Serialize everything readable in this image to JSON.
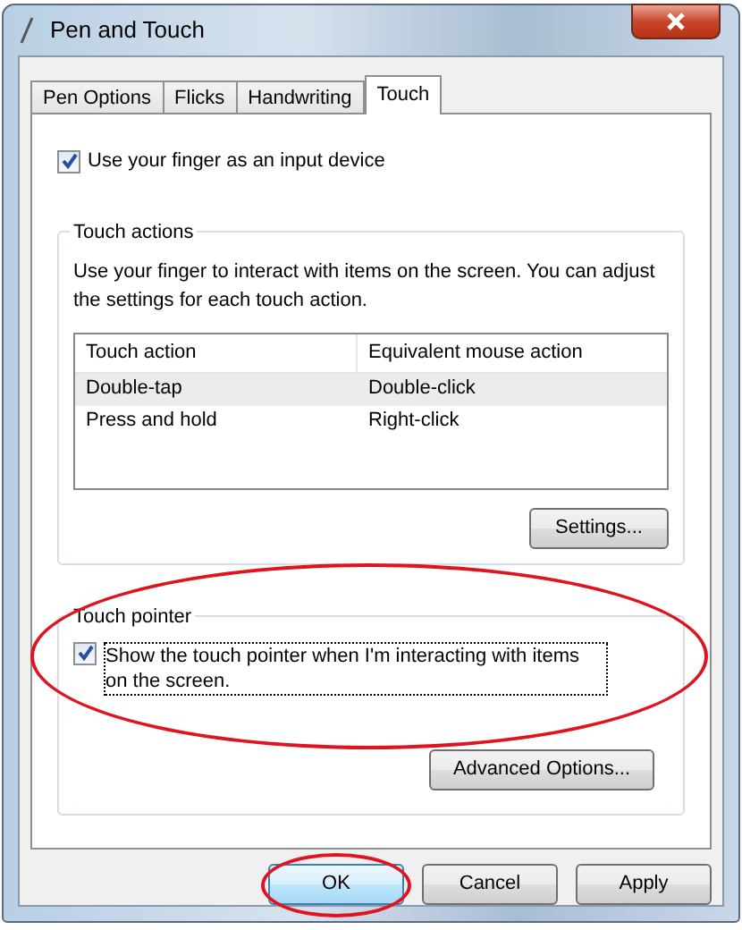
{
  "window": {
    "title": "Pen and Touch"
  },
  "tabs": [
    {
      "label": "Pen Options",
      "selected": false
    },
    {
      "label": "Flicks",
      "selected": false
    },
    {
      "label": "Handwriting",
      "selected": false
    },
    {
      "label": "Touch",
      "selected": true
    }
  ],
  "use_finger": {
    "label": "Use your finger as an input device",
    "checked": true
  },
  "touch_actions": {
    "title": "Touch actions",
    "description": "Use your finger to interact with items on the screen. You can adjust the settings for each touch action.",
    "columns": [
      "Touch action",
      "Equivalent mouse action"
    ],
    "rows": [
      {
        "cells": [
          "Double-tap",
          "Double-click"
        ],
        "selected": true
      },
      {
        "cells": [
          "Press and hold",
          "Right-click"
        ],
        "selected": false
      }
    ],
    "button": "Settings..."
  },
  "touch_pointer": {
    "title": "Touch pointer",
    "label": "Show the touch pointer when I'm interacting with items on the screen.",
    "checked": true,
    "button": "Advanced Options...",
    "highlighted": true
  },
  "buttons": [
    {
      "label": "OK",
      "kind": "default",
      "highlighted": true
    },
    {
      "label": "Cancel",
      "kind": "normal",
      "highlighted": false
    },
    {
      "label": "Apply",
      "kind": "normal",
      "highlighted": false
    }
  ]
}
